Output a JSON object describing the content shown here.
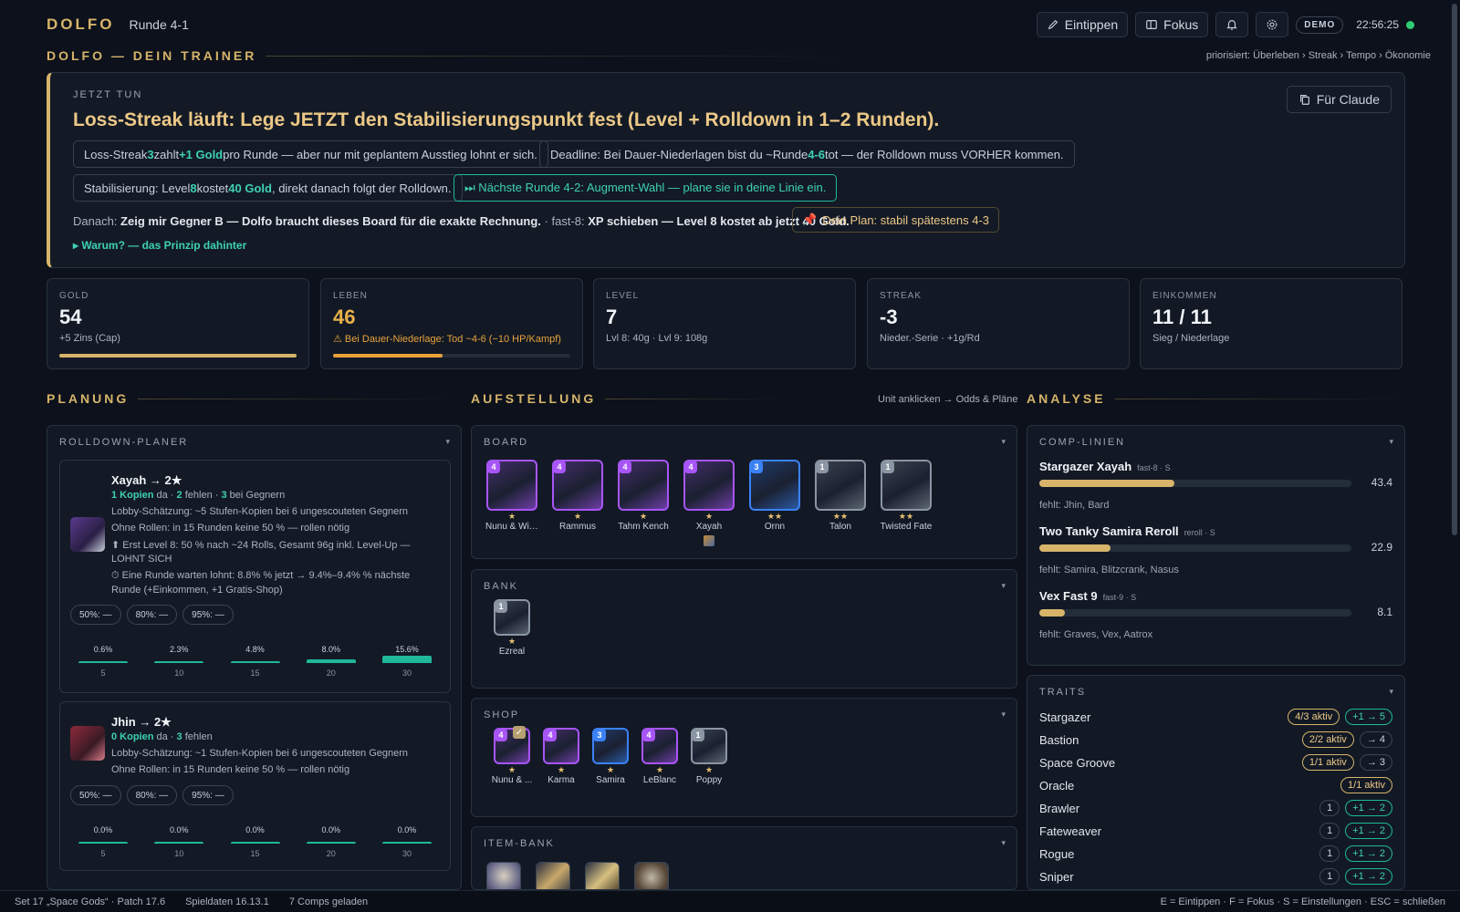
{
  "app": {
    "logo": "DOLFO",
    "round": "Runde 4-1"
  },
  "topbar": {
    "eintippen": "Eintippen",
    "fokus": "Fokus",
    "demo": "DEMO",
    "clock": "22:56:25"
  },
  "trainer": {
    "title": "DOLFO — DEIN TRAINER",
    "prio": "priorisiert: Überleben › Streak › Tempo › Ökonomie"
  },
  "hero": {
    "kicker": "JETZT TUN",
    "headline": "Loss-Streak läuft: Lege JETZT den Stabilisierungspunkt fest (Level + Rolldown in 1–2 Runden).",
    "claude_button": "Für Claude",
    "chip1": {
      "a": "Loss-Streak ",
      "b": "3",
      "c": " zahlt ",
      "d": "+1 Gold",
      "e": " pro Runde — aber nur mit geplantem Ausstieg lohnt er sich."
    },
    "chip2": {
      "a": "Deadline: Bei Dauer-Niederlagen bist du ~Runde ",
      "b": "4-6",
      "c": " tot — der Rolldown muss VORHER kommen."
    },
    "chip3": {
      "a": "Stabilisierung: Level ",
      "b": "8",
      "c": " kostet ",
      "d": "40 Gold",
      "e": ", direkt danach folgt der Rolldown."
    },
    "chip4": "⏭ Nächste Runde 4-2: Augment-Wahl — plane sie in deine Linie ein.",
    "danach_lead": "Danach: ",
    "danach_b1": "Zeig mir Gegner B — Dolfo braucht dieses Board für die exakte Rechnung.",
    "danach_mid": " · fast-8: ",
    "danach_b2": "XP schieben — Level 8 kostet ab jetzt 40 Gold.",
    "plan": "Dein Plan: stabil spätestens 4-3",
    "why": "▸ Warum? — das Prinzip dahinter"
  },
  "stats": [
    {
      "label": "GOLD",
      "value": "54",
      "sub": "+5 Zins (Cap)",
      "bar": 1.0
    },
    {
      "label": "LEBEN",
      "value": "46",
      "sub": "⚠ Bei Dauer-Niederlage: Tod ~4-6 (−10 HP/Kampf)",
      "bar": 0.46
    },
    {
      "label": "LEVEL",
      "value": "7",
      "sub": "Lvl 8: 40g · Lvl 9: 108g"
    },
    {
      "label": "STREAK",
      "value": "-3",
      "sub": "Nieder.-Serie · +1g/Rd"
    },
    {
      "label": "EINKOMMEN",
      "value": "11 / 11",
      "sub": "Sieg / Niederlage"
    }
  ],
  "sections": {
    "planung": "PLANUNG",
    "aufstellung": "AUFSTELLUNG",
    "aufstellung_hint": "Unit anklicken → Odds & Pläne",
    "analyse": "ANALYSE"
  },
  "rolldown": {
    "title": "ROLLDOWN-PLANER",
    "cards": [
      {
        "name": "Xayah → 2★",
        "line1": {
          "a": "1 Kopien",
          "b": " da · ",
          "c": "2",
          "d": " fehlen · ",
          "e": "3",
          "f": " bei Gegnern"
        },
        "line2": "Lobby-Schätzung: ~5 Stufen-Kopien bei 6 ungescouteten Gegnern",
        "line3": "Ohne Rollen: in 15 Runden keine 50 % — rollen nötig",
        "green1": "⬆ Erst Level 8: 50 % nach ~24 Rolls, Gesamt 96g inkl. Level-Up —",
        "green1b": "LOHNT SICH",
        "green2": "⏱ Eine Runde warten lohnt: 8.8% % jetzt → 9.4%–9.4% % nächste",
        "green2b": "Runde (+Einkommen, +1 Gratis-Shop)",
        "pills": [
          "50%: —",
          "80%: —",
          "95%: —"
        ],
        "hist": [
          {
            "x": "5",
            "p": "0.6%",
            "v": 0.6
          },
          {
            "x": "10",
            "p": "2.3%",
            "v": 2.3
          },
          {
            "x": "15",
            "p": "4.8%",
            "v": 4.8
          },
          {
            "x": "20",
            "p": "8.0%",
            "v": 8.0
          },
          {
            "x": "30",
            "p": "15.6%",
            "v": 15.6
          }
        ]
      },
      {
        "name": "Jhin → 2★",
        "line1": {
          "a": "0 Kopien",
          "b": " da · ",
          "c": "3",
          "d": " fehlen"
        },
        "line2": "Lobby-Schätzung: ~1 Stufen-Kopien bei 6 ungescouteten Gegnern",
        "line3": "Ohne Rollen: in 15 Runden keine 50 % — rollen nötig",
        "pills": [
          "50%: —",
          "80%: —",
          "95%: —"
        ],
        "hist": [
          {
            "x": "5",
            "p": "0.0%",
            "v": 0
          },
          {
            "x": "10",
            "p": "0.0%",
            "v": 0
          },
          {
            "x": "15",
            "p": "0.0%",
            "v": 0
          },
          {
            "x": "20",
            "p": "0.0%",
            "v": 0
          },
          {
            "x": "30",
            "p": "0.0%",
            "v": 0
          }
        ]
      }
    ]
  },
  "board": {
    "title": "BOARD",
    "units": [
      {
        "name": "Nunu & Will...",
        "cost": "4",
        "stars": "★",
        "color": "#a855f7"
      },
      {
        "name": "Rammus",
        "cost": "4",
        "stars": "★",
        "color": "#a855f7"
      },
      {
        "name": "Tahm Kench",
        "cost": "4",
        "stars": "★",
        "color": "#a855f7"
      },
      {
        "name": "Xayah",
        "cost": "4",
        "stars": "★",
        "color": "#a855f7"
      },
      {
        "name": "Ornn",
        "cost": "3",
        "stars": "★★",
        "color": "#3b82f6"
      },
      {
        "name": "Talon",
        "cost": "1",
        "stars": "★★",
        "color": "#8b95a3"
      },
      {
        "name": "Twisted Fate",
        "cost": "1",
        "stars": "★★",
        "color": "#8b95a3"
      }
    ]
  },
  "bank": {
    "title": "BANK",
    "units": [
      {
        "name": "Ezreal",
        "cost": "1",
        "stars": "★",
        "color": "#8b95a3"
      }
    ]
  },
  "shop": {
    "title": "SHOP",
    "units": [
      {
        "name": "Nunu & ...",
        "cost": "4",
        "stars": "★",
        "color": "#a855f7"
      },
      {
        "name": "Karma",
        "cost": "4",
        "stars": "★",
        "color": "#a855f7"
      },
      {
        "name": "Samira",
        "cost": "3",
        "stars": "★",
        "color": "#3b82f6"
      },
      {
        "name": "LeBlanc",
        "cost": "4",
        "stars": "★",
        "color": "#a855f7"
      },
      {
        "name": "Poppy",
        "cost": "1",
        "stars": "★",
        "color": "#8b95a3"
      }
    ]
  },
  "itembank": {
    "title": "ITEM-BANK"
  },
  "comps": {
    "title": "COMP-LINIEN",
    "items": [
      {
        "name": "Stargazer Xayah",
        "meta": "fast-8 · S",
        "value": 43.4,
        "value_text": "43.4",
        "missing": "fehlt: Jhin, Bard"
      },
      {
        "name": "Two Tanky Samira Reroll",
        "meta": "reroll · S",
        "value": 22.9,
        "value_text": "22.9",
        "missing": "fehlt: Samira, Blitzcrank, Nasus"
      },
      {
        "name": "Vex Fast 9",
        "meta": "fast-9 · S",
        "value": 8.1,
        "value_text": "8.1",
        "missing": "fehlt: Graves, Vex, Aatrox"
      }
    ]
  },
  "traits": {
    "title": "TRAITS",
    "items": [
      {
        "name": "Stargazer",
        "a": "4/3 aktiv",
        "b": "+1 → 5"
      },
      {
        "name": "Bastion",
        "a": "2/2 aktiv",
        "b": "→ 4"
      },
      {
        "name": "Space Groove",
        "a": "1/1 aktiv",
        "b": "→ 3"
      },
      {
        "name": "Oracle",
        "a": "1/1 aktiv",
        "b": ""
      },
      {
        "name": "Brawler",
        "a": "1",
        "b": "+1 → 2"
      },
      {
        "name": "Fateweaver",
        "a": "1",
        "b": "+1 → 2"
      },
      {
        "name": "Rogue",
        "a": "1",
        "b": "+1 → 2"
      },
      {
        "name": "Sniper",
        "a": "1",
        "b": "+1 → 2"
      }
    ]
  },
  "footer": {
    "set": "Set 17 „Space Gods“ · Patch 17.6",
    "data": "Spieldaten 16.13.1",
    "comps": "7 Comps geladen",
    "keys": "E = Eintippen · F = Fokus · S = Einstellungen · ESC = schließen"
  },
  "colors": {
    "accent": "#d7b46a",
    "teal": "#1fb89a",
    "cost4": "#a855f7",
    "cost3": "#3b82f6",
    "cost1": "#8b95a3"
  }
}
